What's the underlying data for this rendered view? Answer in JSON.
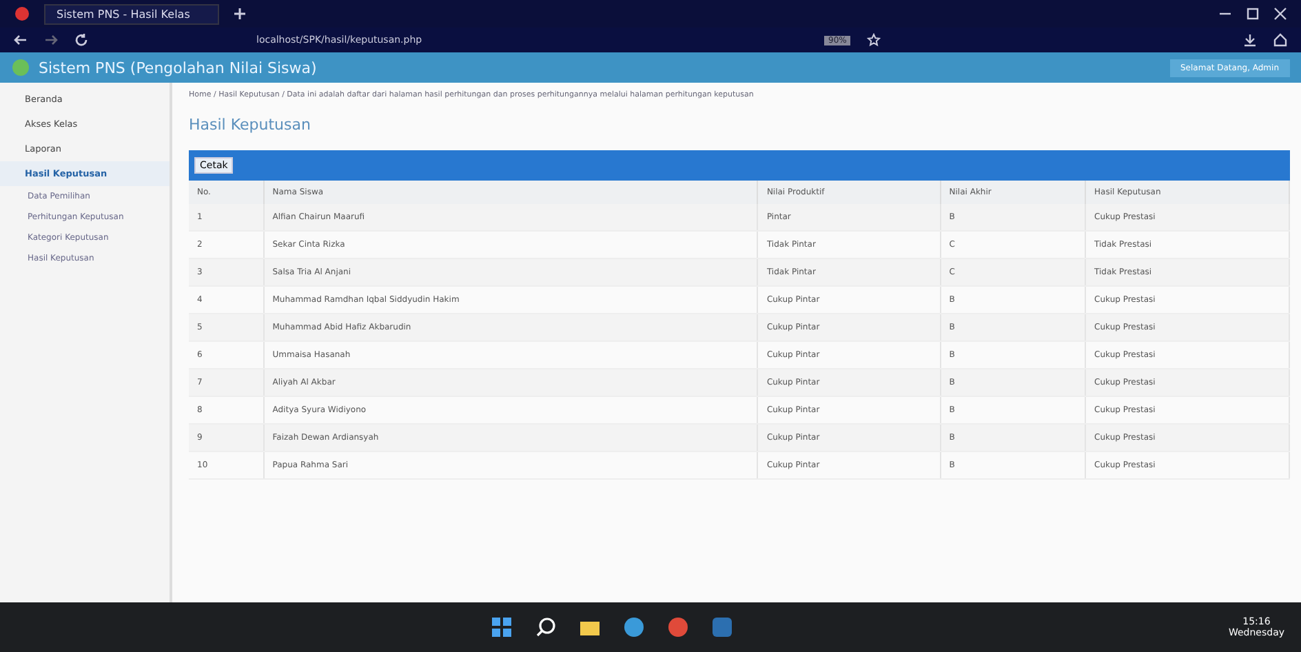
{
  "browser": {
    "tab_title": "Sistem PNS - Hasil Kelas",
    "url": "localhost/SPK/hasil/keputusan.php",
    "zoom": "90%"
  },
  "app": {
    "title": "Sistem PNS (Pengolahan Nilai Siswa)",
    "user": "Selamat Datang, Admin"
  },
  "sidebar": {
    "items": [
      {
        "label": "Beranda",
        "selected": false
      },
      {
        "label": "Akses Kelas",
        "selected": false
      },
      {
        "label": "Laporan",
        "selected": false
      },
      {
        "label": "Hasil Keputusan",
        "selected": true,
        "children": [
          {
            "label": "Data Pemilihan",
            "selected": false
          },
          {
            "label": "Perhitungan Keputusan",
            "selected": false
          },
          {
            "label": "Kategori Keputusan",
            "selected": false
          },
          {
            "label": "Hasil Keputusan",
            "selected": false
          }
        ]
      }
    ]
  },
  "breadcrumb": "Home / Hasil Keputusan / Data ini adalah daftar dari halaman hasil perhitungan dan proses perhitungannya melalui halaman perhitungan keputusan",
  "heading": "Hasil Keputusan",
  "print_button": "Cetak",
  "table": {
    "columns": [
      "No.",
      "Nama Siswa",
      "Nilai Produktif",
      "Nilai Akhir",
      "Hasil Keputusan"
    ],
    "rows": [
      [
        "1",
        "Alfian Chairun Maarufi",
        "Pintar",
        "B",
        "Cukup Prestasi"
      ],
      [
        "2",
        "Sekar Cinta Rizka",
        "Tidak Pintar",
        "C",
        "Tidak Prestasi"
      ],
      [
        "3",
        "Salsa Tria Al Anjani",
        "Tidak Pintar",
        "C",
        "Tidak Prestasi"
      ],
      [
        "4",
        "Muhammad Ramdhan Iqbal Siddyudin Hakim",
        "Cukup Pintar",
        "B",
        "Cukup Prestasi"
      ],
      [
        "5",
        "Muhammad Abid Hafiz Akbarudin",
        "Cukup Pintar",
        "B",
        "Cukup Prestasi"
      ],
      [
        "6",
        "Ummaisa Hasanah",
        "Cukup Pintar",
        "B",
        "Cukup Prestasi"
      ],
      [
        "7",
        "Aliyah Al Akbar",
        "Cukup Pintar",
        "B",
        "Cukup Prestasi"
      ],
      [
        "8",
        "Aditya Syura Widiyono",
        "Cukup Pintar",
        "B",
        "Cukup Prestasi"
      ],
      [
        "9",
        "Faizah Dewan Ardiansyah",
        "Cukup Pintar",
        "B",
        "Cukup Prestasi"
      ],
      [
        "10",
        "Papua Rahma Sari",
        "Cukup Pintar",
        "B",
        "Cukup Prestasi"
      ]
    ]
  },
  "taskbar": {
    "time": "15:16",
    "day": "Wednesday"
  }
}
